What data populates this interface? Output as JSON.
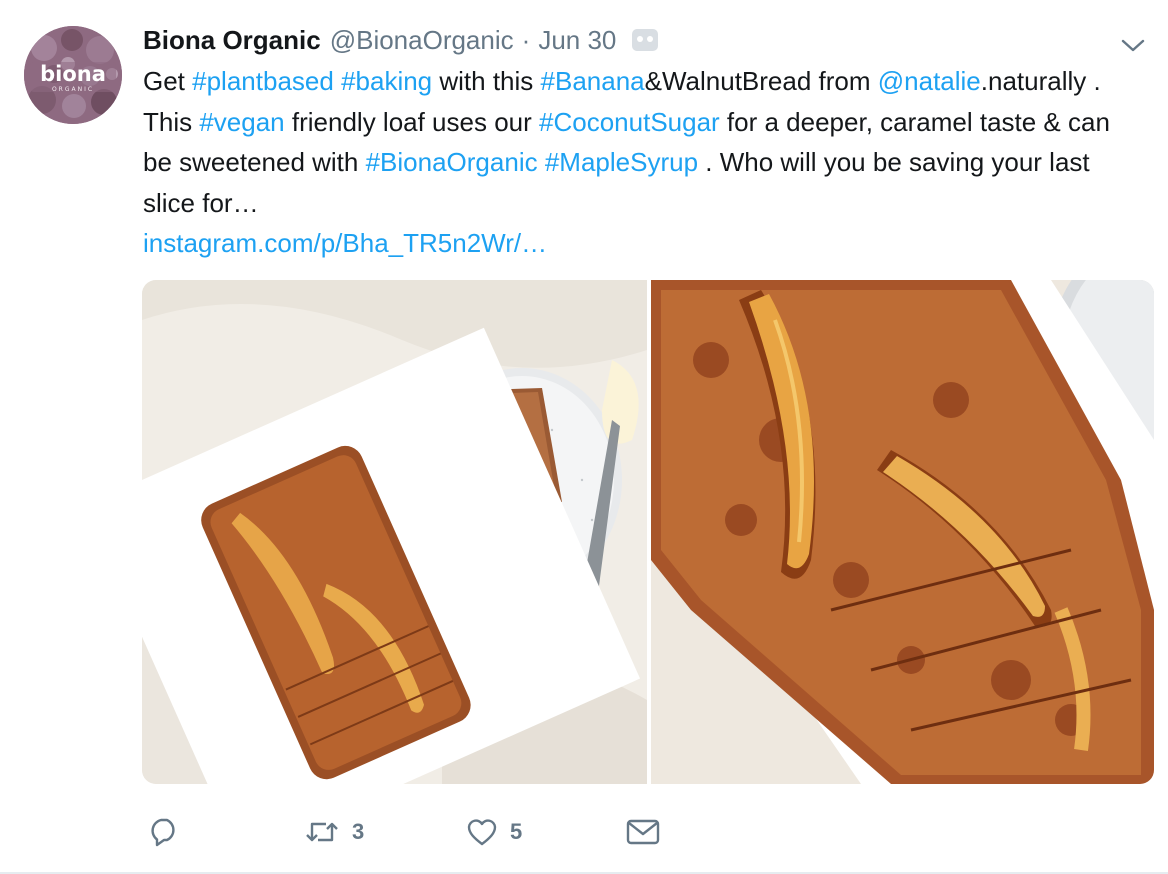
{
  "tweet": {
    "display_name": "Biona Organic",
    "screen_name": "@BionaOrganic",
    "separator": "·",
    "date": "Jun 30",
    "avatar_logo_text": "biona",
    "avatar_logo_subtext": "ORGANIC",
    "text_segments": [
      {
        "text": "Get ",
        "link": false
      },
      {
        "text": "#plantbased",
        "link": true
      },
      {
        "text": " ",
        "link": false
      },
      {
        "text": "#baking",
        "link": true
      },
      {
        "text": " with this ",
        "link": false
      },
      {
        "text": "#Banana",
        "link": true
      },
      {
        "text": "&WalnutBread from ",
        "link": false
      },
      {
        "text": "@natalie",
        "link": true
      },
      {
        "text": ".naturally . This ",
        "link": false
      },
      {
        "text": "#vegan",
        "link": true
      },
      {
        "text": " friendly loaf uses our ",
        "link": false
      },
      {
        "text": "#CoconutSugar",
        "link": true
      },
      {
        "text": " for a deeper, caramel taste & can be sweetened with ",
        "link": false
      },
      {
        "text": "#BionaOrganic",
        "link": true
      },
      {
        "text": " ",
        "link": false
      },
      {
        "text": "#MapleSyrup",
        "link": true
      },
      {
        "text": " . Who will you be saving your last slice for…",
        "link": false
      }
    ],
    "url": "instagram.com/p/Bha_TR5n2Wr/…"
  },
  "actions": {
    "reply_icon": "reply-icon",
    "retweet_icon": "retweet-icon",
    "retweet_count": "3",
    "like_icon": "heart-icon",
    "like_count": "5",
    "message_icon": "envelope-icon"
  },
  "colors": {
    "link": "#1da1f2",
    "secondary": "#657786",
    "text": "#14171a",
    "avatar_bg": "#8e6a81"
  }
}
